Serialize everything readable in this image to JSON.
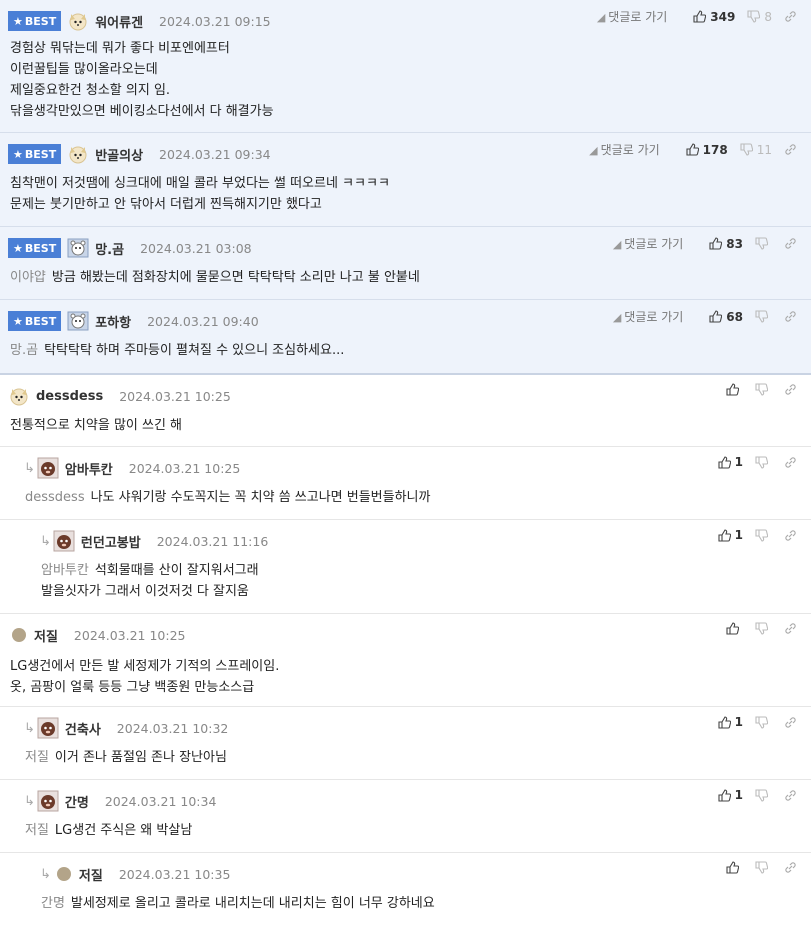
{
  "goto_label": "댓글로 가기",
  "best_label": "BEST",
  "comments": [
    {
      "nick": "워어류겐",
      "date": "2024.03.21 09:15",
      "up": "349",
      "down": "8",
      "lines": [
        "경험상 뭐닦는데 뭐가 좋다 비포엔에프터",
        "이런꿀팁들 많이올라오는데",
        "제일중요한건 청소할 의지 임.",
        "닦을생각만있으면 베이킹소다선에서 다 해결가능"
      ]
    },
    {
      "nick": "반골의상",
      "date": "2024.03.21 09:34",
      "up": "178",
      "down": "11",
      "lines": [
        "침착맨이 저것땜에 싱크대에 매일 콜라 부었다는 썰 떠오르네 ㅋㅋㅋㅋ",
        "문제는 붓기만하고 안 닦아서 더럽게 찐득해지기만 했다고"
      ]
    },
    {
      "nick": "망.곰",
      "date": "2024.03.21 03:08",
      "up": "83",
      "quote": "이야얍",
      "lines": [
        "방금 해봤는데 점화장치에 물묻으면 탁탁탁탁 소리만 나고 불 안붙네"
      ]
    },
    {
      "nick": "포하항",
      "date": "2024.03.21 09:40",
      "up": "68",
      "quote": "망.곰",
      "lines": [
        "탁탁탁탁 하며 주마등이 펼쳐질 수 있으니 조심하세요..."
      ]
    },
    {
      "nick": "dessdess",
      "date": "2024.03.21 10:25",
      "lines": [
        "전통적으로 치약을 많이 쓰긴 해"
      ]
    },
    {
      "nick": "암바투칸",
      "date": "2024.03.21 10:25",
      "up": "1",
      "quote": "dessdess",
      "lines": [
        "나도 샤워기랑 수도꼭지는 꼭 치약 씀 쓰고나면 번들번들하니까"
      ]
    },
    {
      "nick": "런던고봉밥",
      "date": "2024.03.21 11:16",
      "up": "1",
      "quote": "암바투칸",
      "lines": [
        "석회물때를 산이 잘지워서그래",
        "발을싯자가 그래서 이것저것 다 잘지움"
      ]
    },
    {
      "nick": "저질",
      "date": "2024.03.21 10:25",
      "lines": [
        "LG생건에서 만든 발 세정제가 기적의 스프레이임.",
        "옷, 곰팡이 얼룩 등등 그냥 백종원 만능소스급"
      ]
    },
    {
      "nick": "건축사",
      "date": "2024.03.21 10:32",
      "up": "1",
      "quote": "저질",
      "lines": [
        "이거 존나 품절임 존나 장난아님"
      ]
    },
    {
      "nick": "간명",
      "date": "2024.03.21 10:34",
      "up": "1",
      "quote": "저질",
      "lines": [
        "LG생건 주식은 왜 박살남"
      ]
    },
    {
      "nick": "저질",
      "date": "2024.03.21 10:35",
      "quote": "간명",
      "lines": [
        "발세정제로 올리고 콜라로 내리치는데 내리치는 힘이 너무 강하네요"
      ]
    }
  ]
}
